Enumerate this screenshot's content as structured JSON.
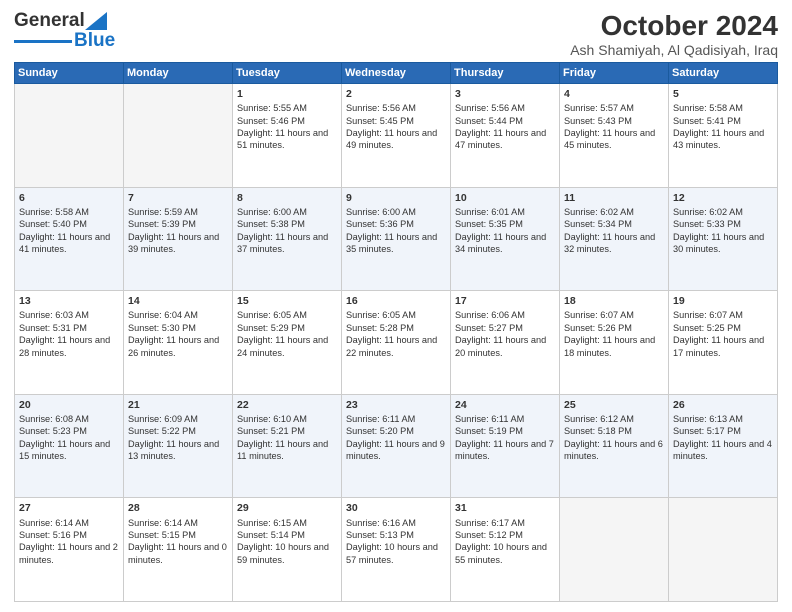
{
  "logo": {
    "text1": "General",
    "text2": "Blue"
  },
  "title": "October 2024",
  "subtitle": "Ash Shamiyah, Al Qadisiyah, Iraq",
  "days_of_week": [
    "Sunday",
    "Monday",
    "Tuesday",
    "Wednesday",
    "Thursday",
    "Friday",
    "Saturday"
  ],
  "weeks": [
    [
      {
        "day": "",
        "content": ""
      },
      {
        "day": "",
        "content": ""
      },
      {
        "day": "1",
        "content": "Sunrise: 5:55 AM\nSunset: 5:46 PM\nDaylight: 11 hours and 51 minutes."
      },
      {
        "day": "2",
        "content": "Sunrise: 5:56 AM\nSunset: 5:45 PM\nDaylight: 11 hours and 49 minutes."
      },
      {
        "day": "3",
        "content": "Sunrise: 5:56 AM\nSunset: 5:44 PM\nDaylight: 11 hours and 47 minutes."
      },
      {
        "day": "4",
        "content": "Sunrise: 5:57 AM\nSunset: 5:43 PM\nDaylight: 11 hours and 45 minutes."
      },
      {
        "day": "5",
        "content": "Sunrise: 5:58 AM\nSunset: 5:41 PM\nDaylight: 11 hours and 43 minutes."
      }
    ],
    [
      {
        "day": "6",
        "content": "Sunrise: 5:58 AM\nSunset: 5:40 PM\nDaylight: 11 hours and 41 minutes."
      },
      {
        "day": "7",
        "content": "Sunrise: 5:59 AM\nSunset: 5:39 PM\nDaylight: 11 hours and 39 minutes."
      },
      {
        "day": "8",
        "content": "Sunrise: 6:00 AM\nSunset: 5:38 PM\nDaylight: 11 hours and 37 minutes."
      },
      {
        "day": "9",
        "content": "Sunrise: 6:00 AM\nSunset: 5:36 PM\nDaylight: 11 hours and 35 minutes."
      },
      {
        "day": "10",
        "content": "Sunrise: 6:01 AM\nSunset: 5:35 PM\nDaylight: 11 hours and 34 minutes."
      },
      {
        "day": "11",
        "content": "Sunrise: 6:02 AM\nSunset: 5:34 PM\nDaylight: 11 hours and 32 minutes."
      },
      {
        "day": "12",
        "content": "Sunrise: 6:02 AM\nSunset: 5:33 PM\nDaylight: 11 hours and 30 minutes."
      }
    ],
    [
      {
        "day": "13",
        "content": "Sunrise: 6:03 AM\nSunset: 5:31 PM\nDaylight: 11 hours and 28 minutes."
      },
      {
        "day": "14",
        "content": "Sunrise: 6:04 AM\nSunset: 5:30 PM\nDaylight: 11 hours and 26 minutes."
      },
      {
        "day": "15",
        "content": "Sunrise: 6:05 AM\nSunset: 5:29 PM\nDaylight: 11 hours and 24 minutes."
      },
      {
        "day": "16",
        "content": "Sunrise: 6:05 AM\nSunset: 5:28 PM\nDaylight: 11 hours and 22 minutes."
      },
      {
        "day": "17",
        "content": "Sunrise: 6:06 AM\nSunset: 5:27 PM\nDaylight: 11 hours and 20 minutes."
      },
      {
        "day": "18",
        "content": "Sunrise: 6:07 AM\nSunset: 5:26 PM\nDaylight: 11 hours and 18 minutes."
      },
      {
        "day": "19",
        "content": "Sunrise: 6:07 AM\nSunset: 5:25 PM\nDaylight: 11 hours and 17 minutes."
      }
    ],
    [
      {
        "day": "20",
        "content": "Sunrise: 6:08 AM\nSunset: 5:23 PM\nDaylight: 11 hours and 15 minutes."
      },
      {
        "day": "21",
        "content": "Sunrise: 6:09 AM\nSunset: 5:22 PM\nDaylight: 11 hours and 13 minutes."
      },
      {
        "day": "22",
        "content": "Sunrise: 6:10 AM\nSunset: 5:21 PM\nDaylight: 11 hours and 11 minutes."
      },
      {
        "day": "23",
        "content": "Sunrise: 6:11 AM\nSunset: 5:20 PM\nDaylight: 11 hours and 9 minutes."
      },
      {
        "day": "24",
        "content": "Sunrise: 6:11 AM\nSunset: 5:19 PM\nDaylight: 11 hours and 7 minutes."
      },
      {
        "day": "25",
        "content": "Sunrise: 6:12 AM\nSunset: 5:18 PM\nDaylight: 11 hours and 6 minutes."
      },
      {
        "day": "26",
        "content": "Sunrise: 6:13 AM\nSunset: 5:17 PM\nDaylight: 11 hours and 4 minutes."
      }
    ],
    [
      {
        "day": "27",
        "content": "Sunrise: 6:14 AM\nSunset: 5:16 PM\nDaylight: 11 hours and 2 minutes."
      },
      {
        "day": "28",
        "content": "Sunrise: 6:14 AM\nSunset: 5:15 PM\nDaylight: 11 hours and 0 minutes."
      },
      {
        "day": "29",
        "content": "Sunrise: 6:15 AM\nSunset: 5:14 PM\nDaylight: 10 hours and 59 minutes."
      },
      {
        "day": "30",
        "content": "Sunrise: 6:16 AM\nSunset: 5:13 PM\nDaylight: 10 hours and 57 minutes."
      },
      {
        "day": "31",
        "content": "Sunrise: 6:17 AM\nSunset: 5:12 PM\nDaylight: 10 hours and 55 minutes."
      },
      {
        "day": "",
        "content": ""
      },
      {
        "day": "",
        "content": ""
      }
    ]
  ]
}
